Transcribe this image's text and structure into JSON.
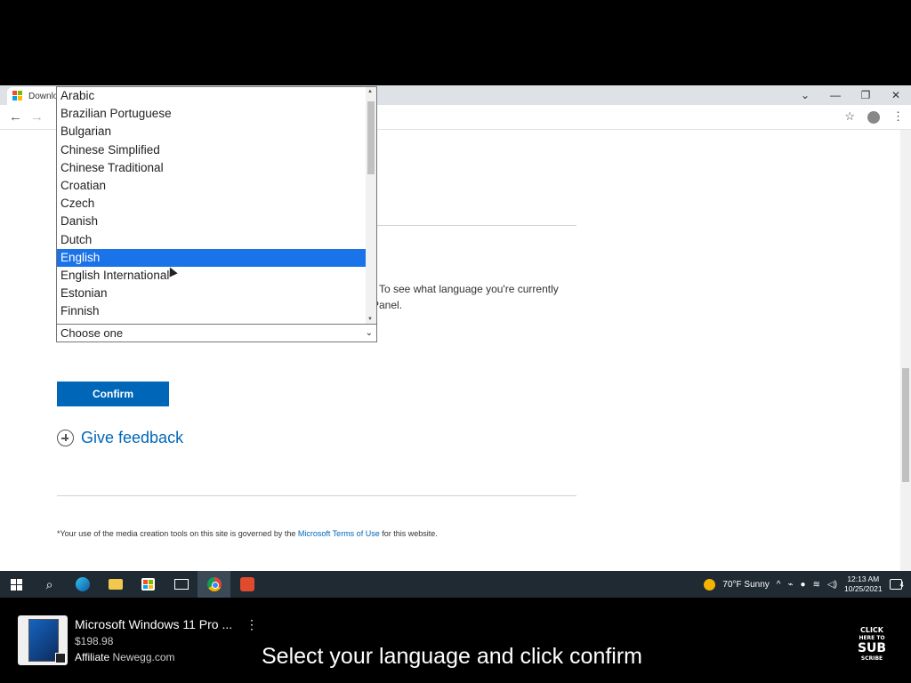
{
  "browser": {
    "tab_title": "Downlo",
    "controls": {
      "collapse": "⌄",
      "minimize": "—",
      "restore": "❐",
      "close": "✕"
    }
  },
  "page": {
    "info_line_1": "To see what language you're currently",
    "info_line_2": "Panel.",
    "select_value": "Choose one",
    "confirm_label": "Confirm",
    "feedback_label": "Give feedback",
    "footer_prefix": "*Your use of the media creation tools on this site is governed by the ",
    "footer_link": "Microsoft Terms of Use",
    "footer_suffix": " for this website."
  },
  "dropdown": {
    "options": [
      "Arabic",
      "Brazilian Portuguese",
      "Bulgarian",
      "Chinese Simplified",
      "Chinese Traditional",
      "Croatian",
      "Czech",
      "Danish",
      "Dutch",
      "English",
      "English International",
      "Estonian",
      "Finnish"
    ],
    "selected_index": 9
  },
  "taskbar": {
    "weather": "70°F  Sunny",
    "time": "12:13 AM",
    "date": "10/25/2021",
    "notif_count": "4"
  },
  "overlay": {
    "product_title": "Microsoft Windows 11 Pro ...",
    "product_price": "$198.98",
    "affiliate_label": "Affiliate",
    "affiliate_store": "Newegg.com",
    "caption": "Select your language and click confirm",
    "sub_line1": "CLICK",
    "sub_line2": "HERE TO",
    "sub_line3": "SUB",
    "sub_line4": "SCRIBE"
  },
  "colors": {
    "accent": "#0067b8",
    "selected_option": "#1a73e8",
    "taskbar": "#1f2a33"
  }
}
